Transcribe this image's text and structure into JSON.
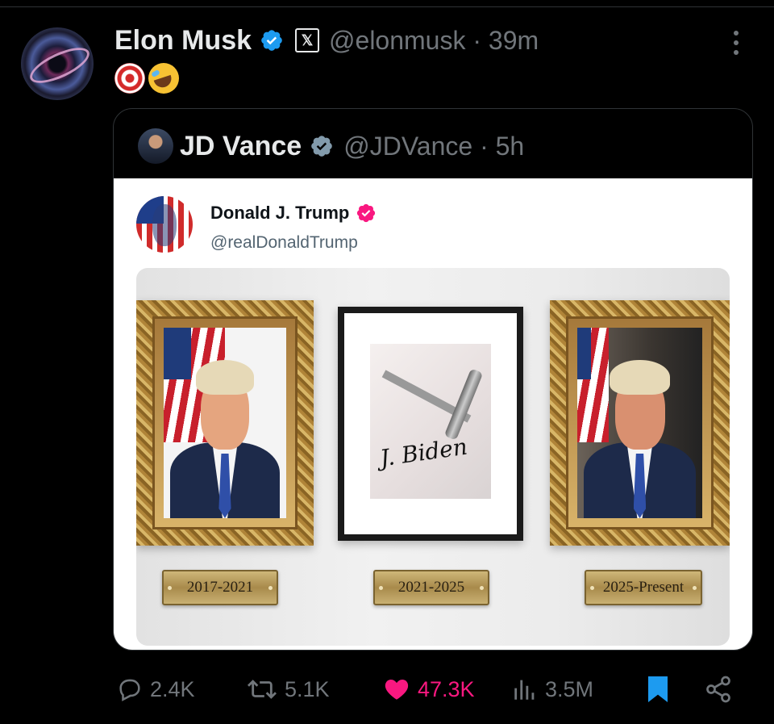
{
  "tweet": {
    "author_name": "Elon Musk",
    "author_handle": "@elonmusk",
    "separator": "·",
    "time": "39m",
    "x_badge": "𝕏",
    "emojis": [
      "target-emoji",
      "rolling-on-floor-laughing-emoji"
    ]
  },
  "quoted": {
    "author_name": "JD Vance",
    "author_handle": "@JDVance",
    "separator": "·",
    "time": "5h",
    "inner": {
      "author_name": "Donald J. Trump",
      "author_handle": "@realDonaldTrump",
      "plaques": [
        "2017-2021",
        "2021-2025",
        "2025-Present"
      ]
    }
  },
  "actions": {
    "replies": "2.4K",
    "reposts": "5.1K",
    "likes": "47.3K",
    "views": "3.5M"
  },
  "colors": {
    "background": "#000000",
    "verified_blue": "#1d9bf0",
    "verified_pink": "#f91880",
    "like_pink": "#f91880",
    "muted": "#71767b",
    "bookmark": "#1d9bf0"
  }
}
